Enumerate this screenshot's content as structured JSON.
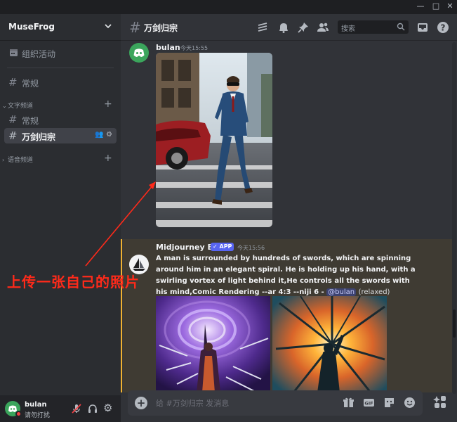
{
  "window": {
    "minimize": "—",
    "maximize": "□",
    "close": "✕"
  },
  "server": {
    "name": "MuseFrog"
  },
  "sidebar": {
    "events": {
      "label": "组织活动"
    },
    "general_top": {
      "label": "常规"
    },
    "category_text": {
      "label": "文字频道"
    },
    "channels": [
      {
        "label": "常规"
      },
      {
        "label": "万剑归宗"
      }
    ],
    "category_voice": {
      "label": "语音频道"
    }
  },
  "user": {
    "name": "bulan",
    "status": "请勿打扰"
  },
  "channel": {
    "name": "万剑归宗"
  },
  "search": {
    "placeholder": "搜索"
  },
  "messages": [
    {
      "author": "bulan",
      "time": "今天15:55"
    },
    {
      "author": "Midjourney Bot",
      "badge": "APP",
      "time": "今天15:56",
      "prompt": "A man is surrounded by hundreds of swords, which are spinning around him in an elegant spiral. He is holding up his hand, with a swirling vortex of light behind it,He controls all the swords with his mind,Comic Rendering --ar 4:3 --niji 6 -",
      "mention": "@bulan",
      "mode": "(relaxed)"
    }
  ],
  "composer": {
    "placeholder": "给 #万剑归宗 发消息"
  },
  "annotation": {
    "text": "上传一张自己的照片",
    "color": "#ff2a1a"
  },
  "colors": {
    "accent": "#5865f2",
    "online_green": "#3ba55c",
    "dnd_red": "#f23f43",
    "highlight_bar": "#f0b232"
  }
}
